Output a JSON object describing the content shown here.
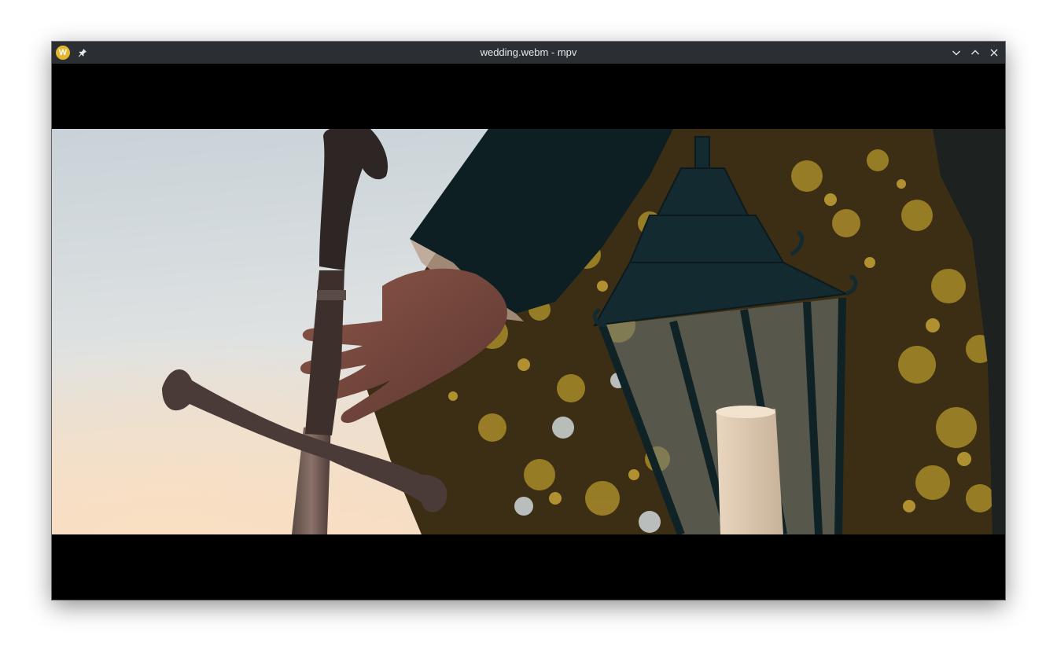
{
  "window": {
    "title": "wedding.webm - mpv",
    "app_icon_letter": "W"
  },
  "titlebar_buttons": {
    "pin": "pin-icon",
    "minimize": "chevron-down-icon",
    "maximize": "chevron-up-icon",
    "close": "close-icon"
  },
  "colors": {
    "titlebar_bg": "#2b2f33",
    "title_text": "#e6e8ea",
    "app_icon": "#e5b72c",
    "letterbox": "#000000"
  }
}
